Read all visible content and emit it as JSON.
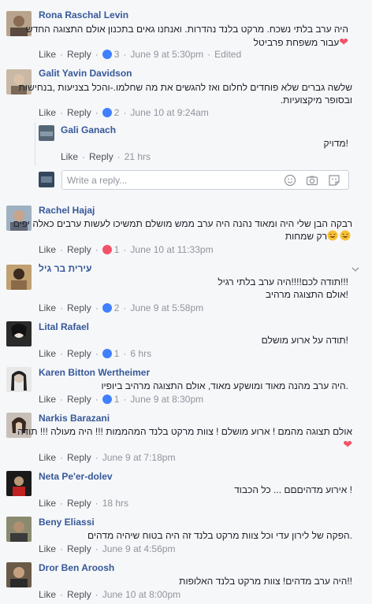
{
  "comments": [
    {
      "name": "Rona Raschal Levin",
      "line1": "היה ערב בלתי נשכח. מרקט בלנד נהדרות. ואנחנו גאים בתכנון אולם התצוגה החדש",
      "line2": "עבור משפחת פרביטל",
      "like": "Like",
      "reply": "Reply",
      "count": "3",
      "time": "June 9 at 5:30pm",
      "edited": "Edited"
    },
    {
      "name": "Galit Yavin Davidson",
      "line1": "שלשה גברים שלא פוחדים לחלום ואז להגשים את מה שחלמו.-והכל בצניעות ,בנחישות",
      "line2": "ובסופר מיקצועיות.",
      "like": "Like",
      "reply": "Reply",
      "count": "2",
      "time": "June 10 at 9:24am"
    },
    {
      "name": "Gali Ganach",
      "line1": "!מדויק",
      "like": "Like",
      "reply": "Reply",
      "time": "21 hrs"
    },
    {
      "name": "Rachel Hajaj",
      "line1": "רבקה הבן שלי היה ומאוד נהנה היה ערב ממש מושלם תמשיכו לעשות ערבים כאלה יפים",
      "line2": "רק שמחות",
      "like": "Like",
      "reply": "Reply",
      "count": "1",
      "time": "June 10 at 11:33pm"
    },
    {
      "name": "עירית בר גיל",
      "line1": "!!!תודה לכם!!!!היה ערב בלתי רגיל",
      "line2": "!אולם התצוגה מרהיב",
      "like": "Like",
      "reply": "Reply",
      "count": "2",
      "time": "June 9 at 5:58pm"
    },
    {
      "name": "Lital Rafael",
      "line1": "!תודה על ארוע מושלם",
      "like": "Like",
      "reply": "Reply",
      "count": "1",
      "time": "6 hrs"
    },
    {
      "name": "Karen Bitton Wertheimer",
      "line1": ".היה ערב מהנה מאוד ומושקע מאוד, אולם התצוגה מרהיב ביופיו",
      "like": "Like",
      "reply": "Reply",
      "count": "1",
      "time": "June 9 at 8:30pm"
    },
    {
      "name": "Narkis Barazani",
      "line1": "אולם תצוגה מהמם ! ארוע מושלם ! צוות מרקט בלנד המהממות !!! היה מעולה !!! תודה",
      "like": "Like",
      "reply": "Reply",
      "time": "June 9 at 7:18pm"
    },
    {
      "name": "Neta Pe'er-dolev",
      "line1": "! אירוע מדהיםםם ... כל הכבוד",
      "like": "Like",
      "reply": "Reply",
      "time": "18 hrs"
    },
    {
      "name": "Beny Eliassi",
      "line1": ".הפקה של לירון עדי וכל צוות מרקט בלנד זה היה בטוח שיהיה מדהים",
      "like": "Like",
      "reply": "Reply",
      "time": "June 9 at 4:56pm"
    },
    {
      "name": "Dror Ben Aroosh",
      "line1": "!!היה ערב מדהים! צוות מרקט בלנד האלופות",
      "like": "Like",
      "reply": "Reply",
      "time": "June 10 at 8:00pm"
    }
  ],
  "reply_box": {
    "placeholder": "Write a reply..."
  },
  "icons": {
    "smile": "smile-icon",
    "camera": "camera-icon",
    "sticker": "sticker-icon"
  },
  "colors": {
    "link": "#365899",
    "like": "#4080ff",
    "love": "#f25268",
    "meta": "#90949c"
  }
}
